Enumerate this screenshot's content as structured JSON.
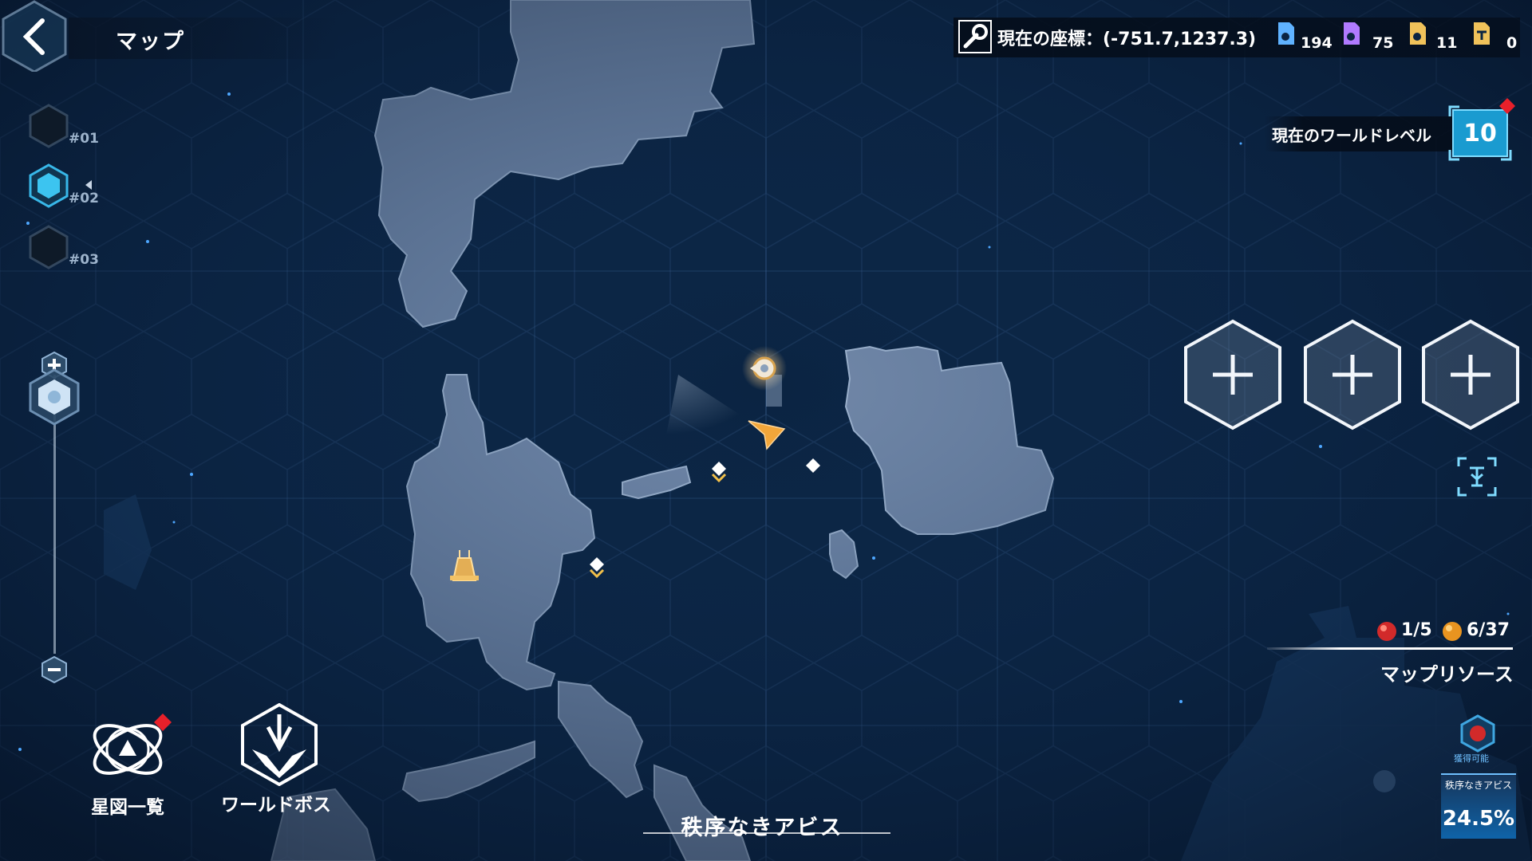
{
  "header": {
    "title": "マップ",
    "back_icon": "chevron-left-icon"
  },
  "floors": [
    {
      "label": "#01",
      "selected": false
    },
    {
      "label": "#02",
      "selected": true
    },
    {
      "label": "#03",
      "selected": false
    }
  ],
  "zoom": {
    "level": 0.08
  },
  "status": {
    "coord_label": "現在の座標：(-751.7,1237.3)",
    "coord_icon": "wrench-icon",
    "resources": [
      {
        "icon": "blue-chip-icon",
        "count": "194",
        "color": "#5fb2ff"
      },
      {
        "icon": "purple-chip-icon",
        "count": "75",
        "color": "#b07aff"
      },
      {
        "icon": "gold-chip-icon",
        "count": "11",
        "color": "#f0c25a"
      },
      {
        "icon": "gold-key-icon",
        "count": "0",
        "color": "#f0c25a"
      }
    ]
  },
  "world_level": {
    "label": "現在のワールドレベル",
    "value": "10"
  },
  "slots": [
    {
      "icon": "plus-icon"
    },
    {
      "icon": "plus-icon"
    },
    {
      "icon": "plus-icon"
    }
  ],
  "map_resources": {
    "red": "1/5",
    "orange": "6/37",
    "label": "マップリソース"
  },
  "abyss_card": {
    "obtainable": "獲得可能",
    "title": "秩序なきアビス",
    "percent": "24.5%"
  },
  "bottom_menu": {
    "star_chart": "星図一覧",
    "world_boss": "ワールドボス"
  },
  "area_name": "秩序なきアビス",
  "colors": {
    "ocean": "#0b2442",
    "land": "#7288a8",
    "accent_cyan": "#1aa7d8",
    "marker_gold": "#f2a63a",
    "alert_red": "#e8202a"
  }
}
